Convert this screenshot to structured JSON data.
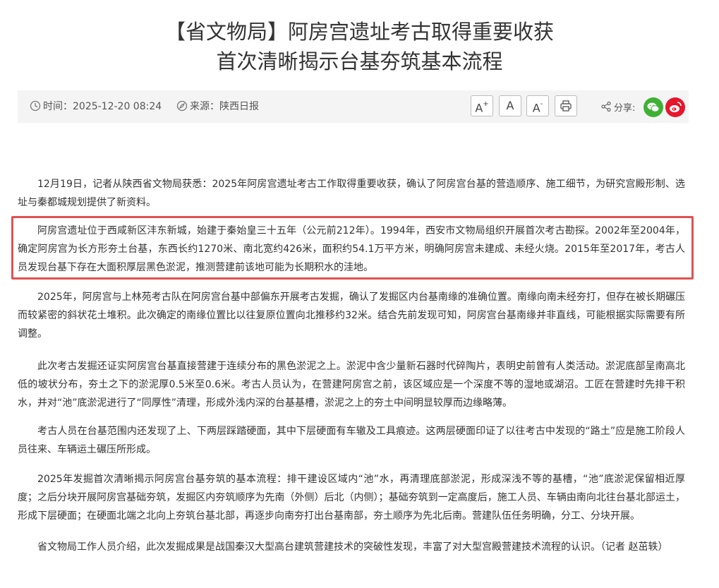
{
  "article": {
    "title_line1": "【省文物局】阿房宫遗址考古取得重要收获",
    "title_line2": "首次清晰揭示台基夯筑基本流程"
  },
  "meta": {
    "time_label": "时间：",
    "time_value": "2025-12-20 08:24",
    "source_label": "来源：",
    "source_value": "陕西日报",
    "font_increase_label": "A",
    "font_increase_sup": "+",
    "font_normal_label": "A",
    "font_decrease_label": "A",
    "font_decrease_sup": "-",
    "share_label": "分享:",
    "icons": [
      "clock-icon",
      "compass-icon",
      "print-icon",
      "share-icon",
      "wechat-icon",
      "weibo-icon"
    ],
    "colors": {
      "wechat": "#3eb135",
      "weibo": "#e6162d",
      "highlight_border": "#e25151"
    }
  },
  "paragraphs": [
    "12月19日，记者从陕西省文物局获悉：2025年阿房宫遗址考古工作取得重要收获，确认了阿房宫台基的营造顺序、施工细节，为研究宫殿形制、选址与秦都城规划提供了新资料。",
    "阿房宫遗址位于西咸新区沣东新城，始建于秦始皇三十五年（公元前212年）。1994年，西安市文物局组织开展首次考古勘探。2002年至2004年，确定阿房宫为长方形夯土台基，东西长约1270米、南北宽约426米，面积约54.1万平方米，明确阿房宫未建成、未经火烧。2015年至2017年，考古人员发现台基下存在大面积厚层黑色淤泥，推测营建前该地可能为长期积水的洼地。",
    "2025年，阿房宫与上林苑考古队在阿房宫台基中部偏东开展考古发掘，确认了发掘区内台基南缘的准确位置。南缘向南未经夯打，但存在被长期碾压而较紧密的斜状花土堆积。此次确定的南缘位置比以往复原位置向北推移约32米。结合先前发现可知，阿房宫台基南缘并非直线，可能根据实际需要有所调整。",
    "此次考古发掘还证实阿房宫台基直接营建于连续分布的黑色淤泥之上。淤泥中含少量新石器时代碎陶片，表明史前曾有人类活动。淤泥底部呈南高北低的坡状分布，夯土之下的淤泥厚0.5米至0.6米。考古人员认为，在营建阿房宫之前，该区域应是一个深度不等的湿地或湖沼。工匠在营建时先排干积水，并对“池”底淤泥进行了“同厚性”清理，形成外浅内深的台基基槽，淤泥之上的夯土中间明显较厚而边缘略薄。",
    "考古人员在台基范围内还发现了上、下两层踩踏硬面，其中下层硬面有车辙及工具痕迹。这两层硬面印证了以往考古中发现的“路土”应是施工阶段人员往来、车辆运土碾压所形成。",
    "2025年发掘首次清晰揭示阿房宫台基夯筑的基本流程：排干建设区域内“池”水，再清理底部淤泥，形成深浅不等的基槽，“池”底淤泥保留相近厚度；之后分块开展阿房宫基础夯筑，发掘区内夯筑顺序为先南（外侧）后北（内侧）；基础夯筑到一定高度后，施工人员、车辆由南向北往台基北部运土，形成下层硬面；在硬面北端之北向上夯筑台基北部，再逐步向南夯打出台基南部，夯土顺序为先北后南。营建队伍任务明确，分工、分块开展。",
    "省文物局工作人员介绍，此次发掘成果是战国秦汉大型高台建筑营建技术的突破性发现，丰富了对大型宫殿营建技术流程的认识。（记者  赵茁轶）"
  ]
}
